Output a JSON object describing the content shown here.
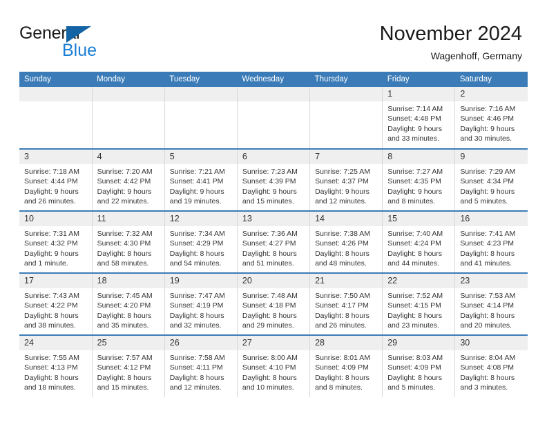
{
  "brand": {
    "name_part1": "General",
    "name_part2": "Blue",
    "accent_color": "#1c7fd4",
    "triangle_color": "#1464a5"
  },
  "header": {
    "title": "November 2024",
    "subtitle": "Wagenhoff, Germany"
  },
  "calendar": {
    "header_bg": "#3b7cb8",
    "daynum_bg": "#efefef",
    "weekday_headers": [
      "Sunday",
      "Monday",
      "Tuesday",
      "Wednesday",
      "Thursday",
      "Friday",
      "Saturday"
    ],
    "weeks": [
      [
        {
          "day": "",
          "sunrise": "",
          "sunset": "",
          "daylight": ""
        },
        {
          "day": "",
          "sunrise": "",
          "sunset": "",
          "daylight": ""
        },
        {
          "day": "",
          "sunrise": "",
          "sunset": "",
          "daylight": ""
        },
        {
          "day": "",
          "sunrise": "",
          "sunset": "",
          "daylight": ""
        },
        {
          "day": "",
          "sunrise": "",
          "sunset": "",
          "daylight": ""
        },
        {
          "day": "1",
          "sunrise": "Sunrise: 7:14 AM",
          "sunset": "Sunset: 4:48 PM",
          "daylight": "Daylight: 9 hours and 33 minutes."
        },
        {
          "day": "2",
          "sunrise": "Sunrise: 7:16 AM",
          "sunset": "Sunset: 4:46 PM",
          "daylight": "Daylight: 9 hours and 30 minutes."
        }
      ],
      [
        {
          "day": "3",
          "sunrise": "Sunrise: 7:18 AM",
          "sunset": "Sunset: 4:44 PM",
          "daylight": "Daylight: 9 hours and 26 minutes."
        },
        {
          "day": "4",
          "sunrise": "Sunrise: 7:20 AM",
          "sunset": "Sunset: 4:42 PM",
          "daylight": "Daylight: 9 hours and 22 minutes."
        },
        {
          "day": "5",
          "sunrise": "Sunrise: 7:21 AM",
          "sunset": "Sunset: 4:41 PM",
          "daylight": "Daylight: 9 hours and 19 minutes."
        },
        {
          "day": "6",
          "sunrise": "Sunrise: 7:23 AM",
          "sunset": "Sunset: 4:39 PM",
          "daylight": "Daylight: 9 hours and 15 minutes."
        },
        {
          "day": "7",
          "sunrise": "Sunrise: 7:25 AM",
          "sunset": "Sunset: 4:37 PM",
          "daylight": "Daylight: 9 hours and 12 minutes."
        },
        {
          "day": "8",
          "sunrise": "Sunrise: 7:27 AM",
          "sunset": "Sunset: 4:35 PM",
          "daylight": "Daylight: 9 hours and 8 minutes."
        },
        {
          "day": "9",
          "sunrise": "Sunrise: 7:29 AM",
          "sunset": "Sunset: 4:34 PM",
          "daylight": "Daylight: 9 hours and 5 minutes."
        }
      ],
      [
        {
          "day": "10",
          "sunrise": "Sunrise: 7:31 AM",
          "sunset": "Sunset: 4:32 PM",
          "daylight": "Daylight: 9 hours and 1 minute."
        },
        {
          "day": "11",
          "sunrise": "Sunrise: 7:32 AM",
          "sunset": "Sunset: 4:30 PM",
          "daylight": "Daylight: 8 hours and 58 minutes."
        },
        {
          "day": "12",
          "sunrise": "Sunrise: 7:34 AM",
          "sunset": "Sunset: 4:29 PM",
          "daylight": "Daylight: 8 hours and 54 minutes."
        },
        {
          "day": "13",
          "sunrise": "Sunrise: 7:36 AM",
          "sunset": "Sunset: 4:27 PM",
          "daylight": "Daylight: 8 hours and 51 minutes."
        },
        {
          "day": "14",
          "sunrise": "Sunrise: 7:38 AM",
          "sunset": "Sunset: 4:26 PM",
          "daylight": "Daylight: 8 hours and 48 minutes."
        },
        {
          "day": "15",
          "sunrise": "Sunrise: 7:40 AM",
          "sunset": "Sunset: 4:24 PM",
          "daylight": "Daylight: 8 hours and 44 minutes."
        },
        {
          "day": "16",
          "sunrise": "Sunrise: 7:41 AM",
          "sunset": "Sunset: 4:23 PM",
          "daylight": "Daylight: 8 hours and 41 minutes."
        }
      ],
      [
        {
          "day": "17",
          "sunrise": "Sunrise: 7:43 AM",
          "sunset": "Sunset: 4:22 PM",
          "daylight": "Daylight: 8 hours and 38 minutes."
        },
        {
          "day": "18",
          "sunrise": "Sunrise: 7:45 AM",
          "sunset": "Sunset: 4:20 PM",
          "daylight": "Daylight: 8 hours and 35 minutes."
        },
        {
          "day": "19",
          "sunrise": "Sunrise: 7:47 AM",
          "sunset": "Sunset: 4:19 PM",
          "daylight": "Daylight: 8 hours and 32 minutes."
        },
        {
          "day": "20",
          "sunrise": "Sunrise: 7:48 AM",
          "sunset": "Sunset: 4:18 PM",
          "daylight": "Daylight: 8 hours and 29 minutes."
        },
        {
          "day": "21",
          "sunrise": "Sunrise: 7:50 AM",
          "sunset": "Sunset: 4:17 PM",
          "daylight": "Daylight: 8 hours and 26 minutes."
        },
        {
          "day": "22",
          "sunrise": "Sunrise: 7:52 AM",
          "sunset": "Sunset: 4:15 PM",
          "daylight": "Daylight: 8 hours and 23 minutes."
        },
        {
          "day": "23",
          "sunrise": "Sunrise: 7:53 AM",
          "sunset": "Sunset: 4:14 PM",
          "daylight": "Daylight: 8 hours and 20 minutes."
        }
      ],
      [
        {
          "day": "24",
          "sunrise": "Sunrise: 7:55 AM",
          "sunset": "Sunset: 4:13 PM",
          "daylight": "Daylight: 8 hours and 18 minutes."
        },
        {
          "day": "25",
          "sunrise": "Sunrise: 7:57 AM",
          "sunset": "Sunset: 4:12 PM",
          "daylight": "Daylight: 8 hours and 15 minutes."
        },
        {
          "day": "26",
          "sunrise": "Sunrise: 7:58 AM",
          "sunset": "Sunset: 4:11 PM",
          "daylight": "Daylight: 8 hours and 12 minutes."
        },
        {
          "day": "27",
          "sunrise": "Sunrise: 8:00 AM",
          "sunset": "Sunset: 4:10 PM",
          "daylight": "Daylight: 8 hours and 10 minutes."
        },
        {
          "day": "28",
          "sunrise": "Sunrise: 8:01 AM",
          "sunset": "Sunset: 4:09 PM",
          "daylight": "Daylight: 8 hours and 8 minutes."
        },
        {
          "day": "29",
          "sunrise": "Sunrise: 8:03 AM",
          "sunset": "Sunset: 4:09 PM",
          "daylight": "Daylight: 8 hours and 5 minutes."
        },
        {
          "day": "30",
          "sunrise": "Sunrise: 8:04 AM",
          "sunset": "Sunset: 4:08 PM",
          "daylight": "Daylight: 8 hours and 3 minutes."
        }
      ]
    ]
  }
}
